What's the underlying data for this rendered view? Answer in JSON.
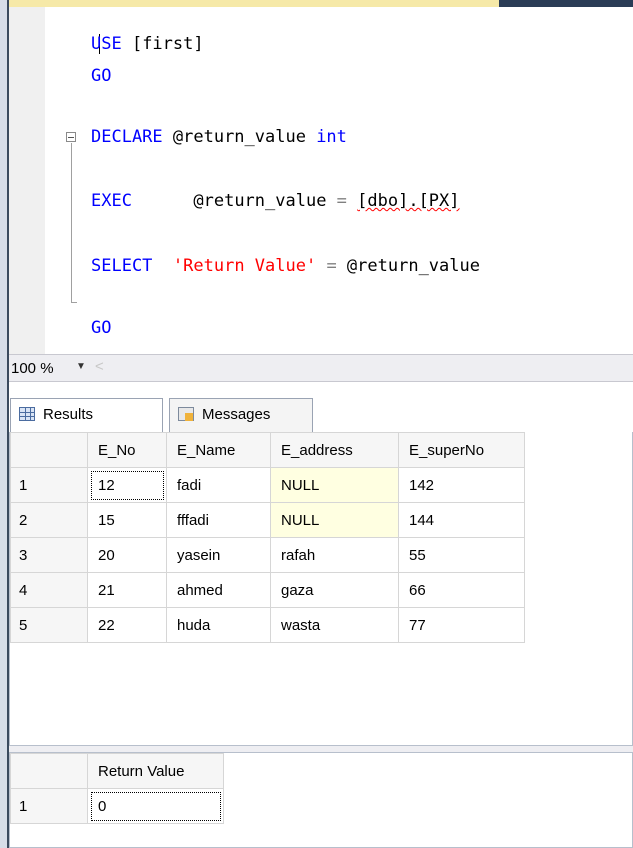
{
  "editor": {
    "lines": {
      "use_kw": "USE",
      "use_db": " [first]",
      "go1": "GO",
      "declare_kw": "DECLARE",
      "declare_var": " @return_value ",
      "declare_type": "int",
      "exec_kw": "EXEC",
      "exec_var": "@return_value",
      "exec_eq": " = ",
      "exec_proc": "[dbo].[PX]",
      "select_kw": "SELECT",
      "select_str": "'Return Value'",
      "select_eq": " = ",
      "select_var": "@return_value",
      "go2": "GO"
    }
  },
  "zoom": {
    "value": "100 %"
  },
  "tabs": {
    "results": "Results",
    "messages": "Messages"
  },
  "results_grid": {
    "columns": [
      "E_No",
      "E_Name",
      "E_address",
      "E_superNo"
    ],
    "rows": [
      {
        "num": "1",
        "cells": [
          "12",
          "fadi",
          "NULL",
          "142"
        ]
      },
      {
        "num": "2",
        "cells": [
          "15",
          "fffadi",
          "NULL",
          "144"
        ]
      },
      {
        "num": "3",
        "cells": [
          "20",
          "yasein",
          "rafah",
          "55"
        ]
      },
      {
        "num": "4",
        "cells": [
          "21",
          "ahmed",
          "gaza",
          "66"
        ]
      },
      {
        "num": "5",
        "cells": [
          "22",
          "huda",
          "wasta",
          "77"
        ]
      }
    ]
  },
  "return_grid": {
    "columns": [
      "Return Value"
    ],
    "rows": [
      {
        "num": "1",
        "cells": [
          "0"
        ]
      }
    ]
  },
  "colors": {
    "keyword": "#0000ff",
    "string": "#ff0000",
    "null_highlight": "#ffffe1"
  }
}
